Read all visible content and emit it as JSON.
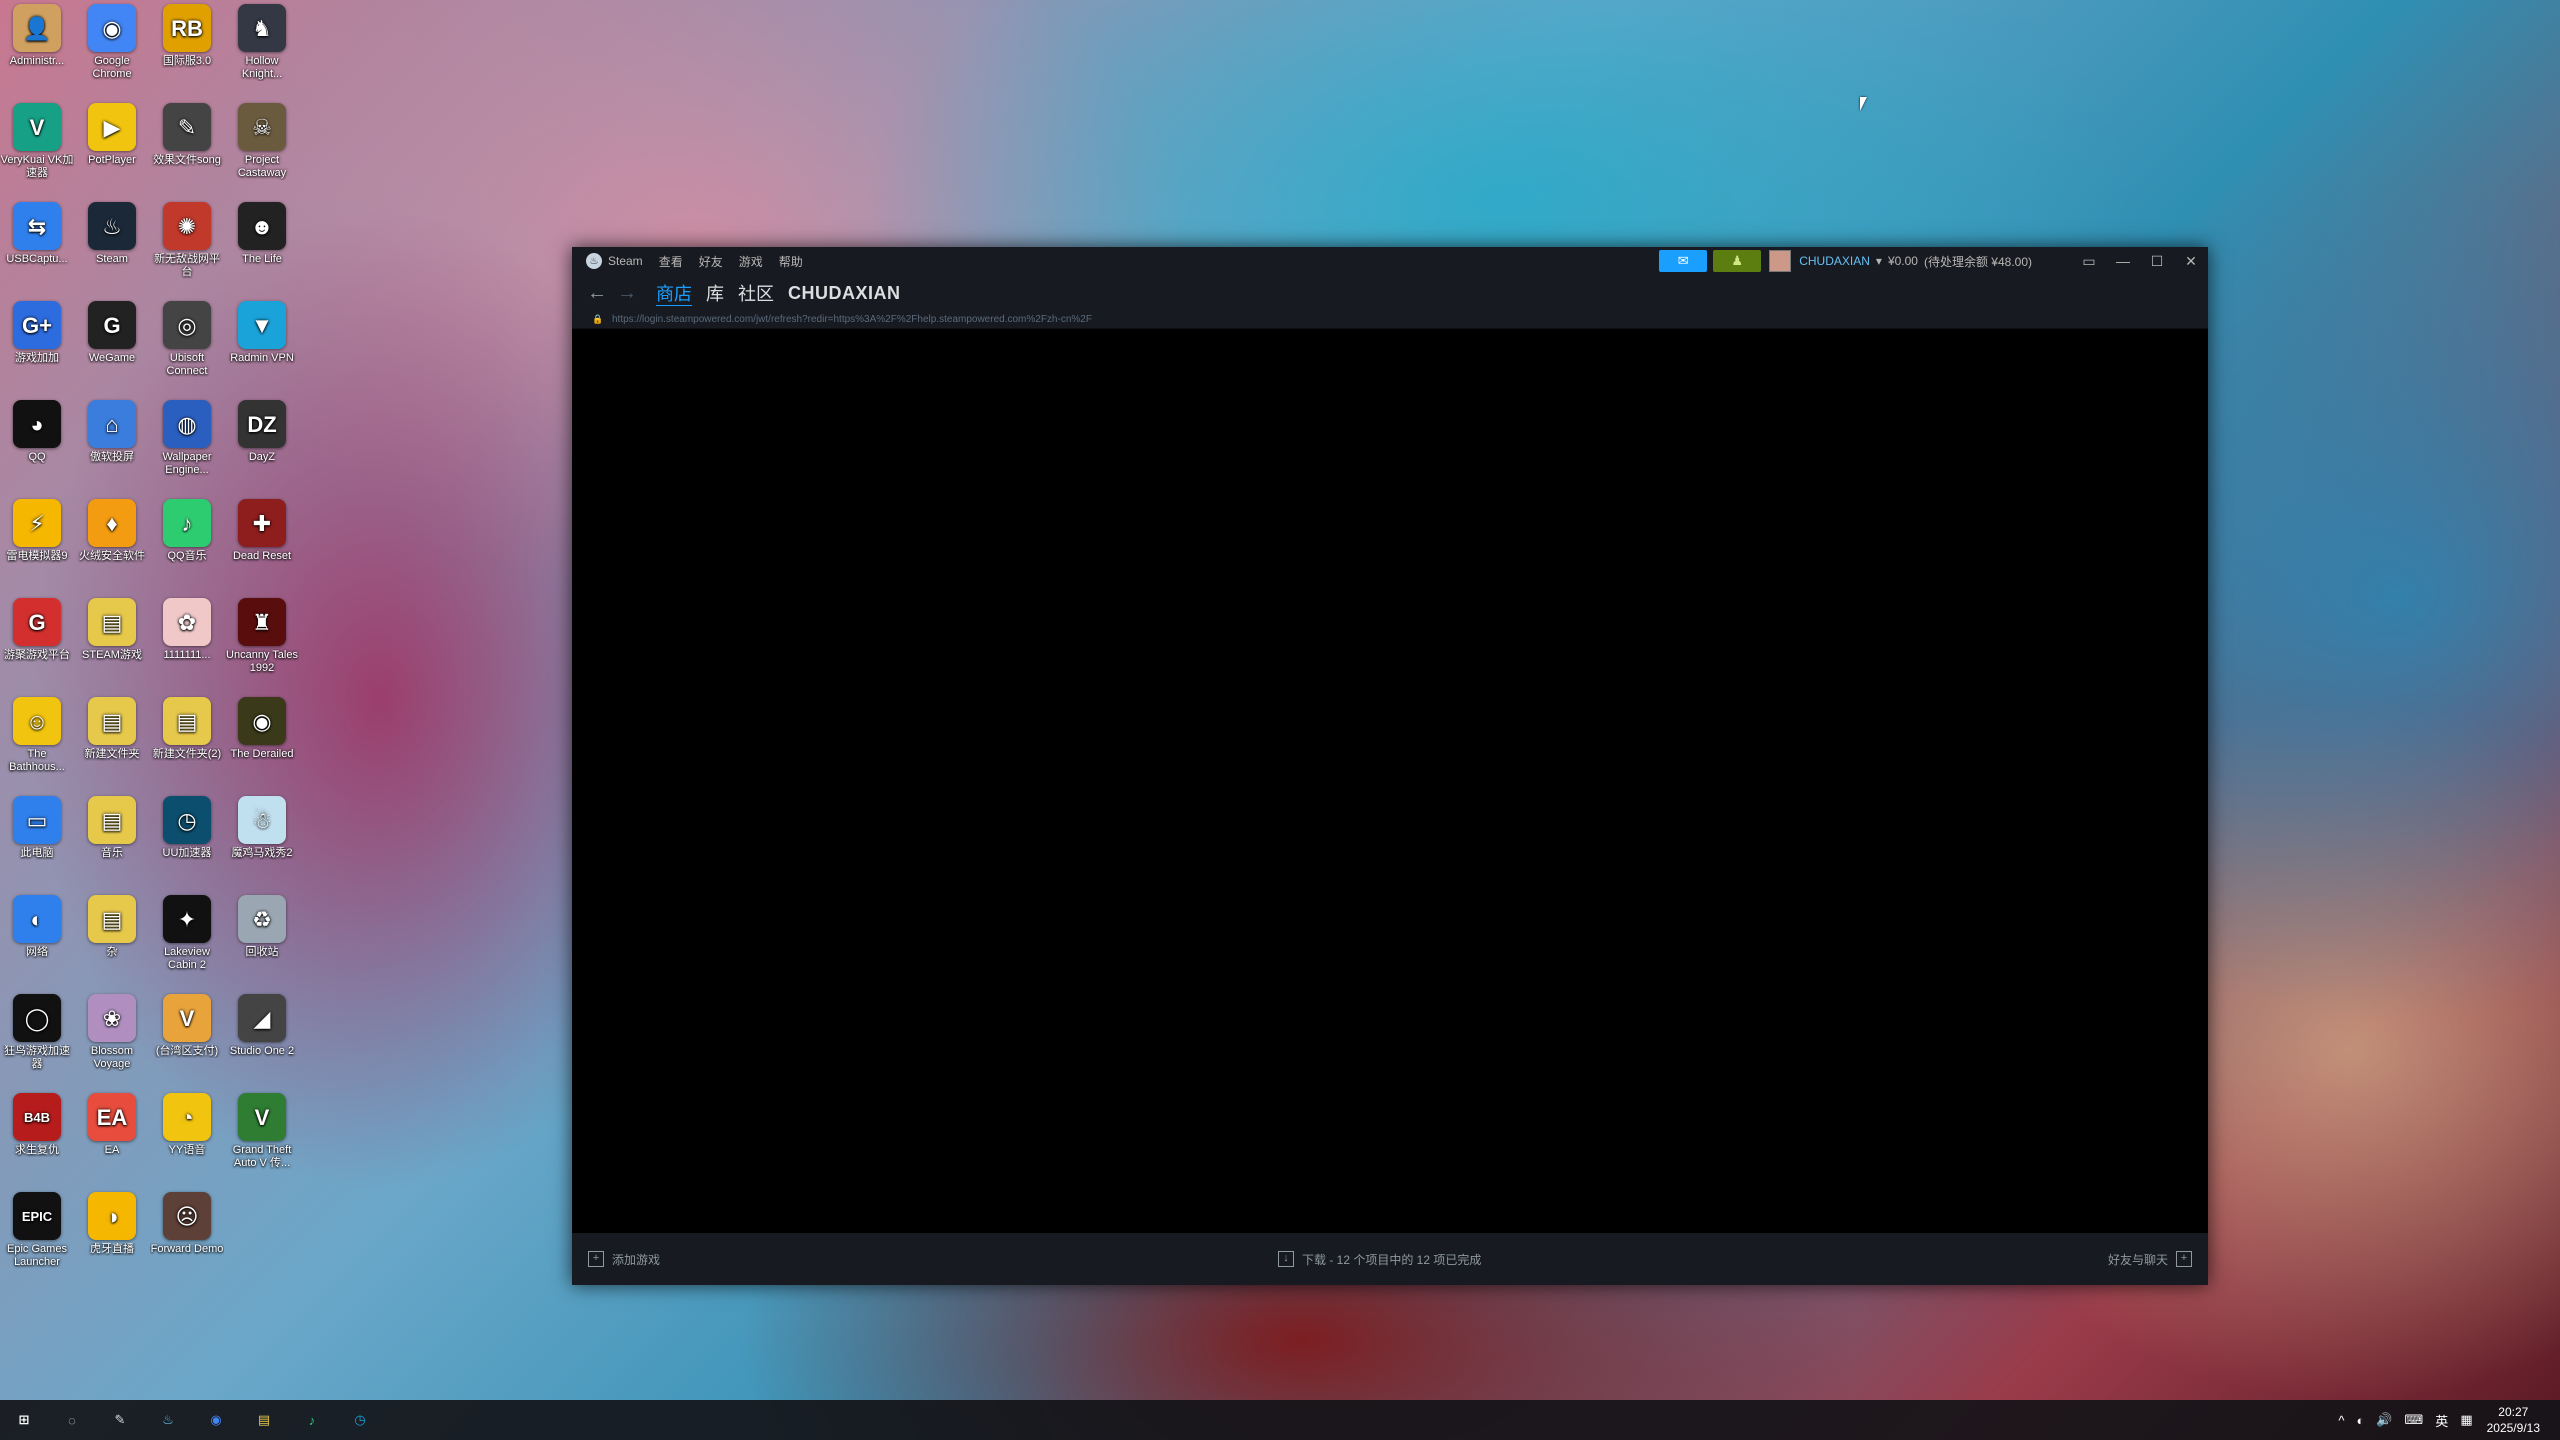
{
  "desktop": {
    "icons": [
      {
        "label": "Administr...",
        "glyph": "👤",
        "color": "#d0a060"
      },
      {
        "label": "Google Chrome",
        "glyph": "◉",
        "color": "#4285f4"
      },
      {
        "label": "国际服3.0",
        "glyph": "RB",
        "color": "#e0a000"
      },
      {
        "label": "Hollow Knight...",
        "glyph": "♞",
        "color": "#333844"
      },
      {
        "label": "VeryKuai VK加速器",
        "glyph": "V",
        "color": "#16a085"
      },
      {
        "label": "PotPlayer",
        "glyph": "▶",
        "color": "#f1c40f"
      },
      {
        "label": "效果文件song",
        "glyph": "✎",
        "color": "#444"
      },
      {
        "label": "Project Castaway",
        "glyph": "☠",
        "color": "#6b5b3e"
      },
      {
        "label": "USBCaptu...",
        "glyph": "⇆",
        "color": "#2f80ed"
      },
      {
        "label": "Steam",
        "glyph": "♨",
        "color": "#1b2838"
      },
      {
        "label": "新无敌战网平台",
        "glyph": "✺",
        "color": "#c0392b"
      },
      {
        "label": "The Life",
        "glyph": "☻",
        "color": "#222"
      },
      {
        "label": "游戏加加",
        "glyph": "G+",
        "color": "#2d6cdf"
      },
      {
        "label": "WeGame",
        "glyph": "G",
        "color": "#222"
      },
      {
        "label": "Ubisoft Connect",
        "glyph": "◎",
        "color": "#444"
      },
      {
        "label": "Radmin VPN",
        "glyph": "▼",
        "color": "#1aa3d9"
      },
      {
        "label": "QQ",
        "glyph": "◕",
        "color": "#111"
      },
      {
        "label": "傲软投屏",
        "glyph": "⌂",
        "color": "#3b7ddd"
      },
      {
        "label": "Wallpaper Engine...",
        "glyph": "◍",
        "color": "#2b5fbf"
      },
      {
        "label": "DayZ",
        "glyph": "DZ",
        "color": "#333"
      },
      {
        "label": "雷电模拟器9",
        "glyph": "⚡",
        "color": "#f5b700"
      },
      {
        "label": "火绒安全软件",
        "glyph": "♦",
        "color": "#f39c12"
      },
      {
        "label": "QQ音乐",
        "glyph": "♪",
        "color": "#2ecc71"
      },
      {
        "label": "Dead Reset",
        "glyph": "✚",
        "color": "#8e1e1e"
      },
      {
        "label": "游聚游戏平台",
        "glyph": "G",
        "color": "#d32f2f"
      },
      {
        "label": "STEAM游戏",
        "glyph": "▤",
        "color": "#e6c84b"
      },
      {
        "label": "1111111...",
        "glyph": "✿",
        "color": "#f0c8c8"
      },
      {
        "label": "Uncanny Tales 1992",
        "glyph": "♜",
        "color": "#5a0d0d"
      },
      {
        "label": "The Bathhous...",
        "glyph": "☺",
        "color": "#f1c40f"
      },
      {
        "label": "新建文件夹",
        "glyph": "▤",
        "color": "#e6c84b"
      },
      {
        "label": "新建文件夹(2)",
        "glyph": "▤",
        "color": "#e6c84b"
      },
      {
        "label": "The Derailed",
        "glyph": "◉",
        "color": "#3a3a1a"
      },
      {
        "label": "此电脑",
        "glyph": "▭",
        "color": "#2f80ed"
      },
      {
        "label": "音乐",
        "glyph": "▤",
        "color": "#e6c84b"
      },
      {
        "label": "UU加速器",
        "glyph": "◷",
        "color": "#0b4e6e"
      },
      {
        "label": "魔鸡马戏秀2",
        "glyph": "☃",
        "color": "#c0e0f0"
      },
      {
        "label": "网络",
        "glyph": "◐",
        "color": "#2f80ed"
      },
      {
        "label": "杂",
        "glyph": "▤",
        "color": "#e6c84b"
      },
      {
        "label": "Lakeview Cabin 2",
        "glyph": "✦",
        "color": "#111"
      },
      {
        "label": "回收站",
        "glyph": "♻",
        "color": "#9aa6b2"
      },
      {
        "label": "狂鸟游戏加速器",
        "glyph": "◯",
        "color": "#111"
      },
      {
        "label": "Blossom Voyage",
        "glyph": "❀",
        "color": "#b08fc0"
      },
      {
        "label": "(台湾区支付)",
        "glyph": "V",
        "color": "#e9a33b"
      },
      {
        "label": "Studio One 2",
        "glyph": "◢",
        "color": "#444"
      },
      {
        "label": "求生复仇",
        "glyph": "B4B",
        "color": "#b71c1c"
      },
      {
        "label": "EA",
        "glyph": "EA",
        "color": "#e74c3c"
      },
      {
        "label": "YY语音",
        "glyph": "◔",
        "color": "#f1c40f"
      },
      {
        "label": "Grand Theft Auto V 传...",
        "glyph": "V",
        "color": "#2e7d32"
      },
      {
        "label": "Epic Games Launcher",
        "glyph": "EPIC",
        "color": "#111"
      },
      {
        "label": "虎牙直播",
        "glyph": "◑",
        "color": "#f5b700"
      },
      {
        "label": "Forward Demo",
        "glyph": "☹",
        "color": "#5d4037"
      }
    ]
  },
  "steam": {
    "menu": [
      "Steam",
      "查看",
      "好友",
      "游戏",
      "帮助"
    ],
    "announce_icon": "megaphone-icon",
    "notify_icon": "bell-icon",
    "account": {
      "name": "CHUDAXIAN",
      "balance": "¥0.00",
      "pending": "(待处理余额 ¥48.00)"
    },
    "window_controls": [
      "▭",
      "—",
      "☐",
      "✕"
    ],
    "nav": {
      "back": "←",
      "forward": "→",
      "tabs": [
        "商店",
        "库",
        "社区",
        "CHUDAXIAN"
      ]
    },
    "url": "https://login.steampowered.com/jwt/refresh?redir=https%3A%2F%2Fhelp.steampowered.com%2Fzh-cn%2F",
    "footer": {
      "add_game": "添加游戏",
      "downloads": "下载 - 12 个项目中的 12 项已完成",
      "friends": "好友与聊天"
    }
  },
  "taskbar": {
    "icons": [
      {
        "name": "windows-start-icon",
        "glyph": "⊞",
        "color": "#fff"
      },
      {
        "name": "app-circle-icon",
        "glyph": "◌",
        "color": "#ddd"
      },
      {
        "name": "app-pen-icon",
        "glyph": "✎",
        "color": "#ddd"
      },
      {
        "name": "steam-icon",
        "glyph": "♨",
        "color": "#66c0f4"
      },
      {
        "name": "chrome-icon",
        "glyph": "◉",
        "color": "#4285f4"
      },
      {
        "name": "folder-icon",
        "glyph": "▤",
        "color": "#e6c84b"
      },
      {
        "name": "qqmusic-icon",
        "glyph": "♪",
        "color": "#2ecc71"
      },
      {
        "name": "uu-icon",
        "glyph": "◷",
        "color": "#1aa3d9"
      }
    ],
    "tray": [
      "^",
      "◐",
      "🔊",
      "⌨",
      "英",
      "▦"
    ],
    "time": "20:27",
    "date": "2025/9/13"
  }
}
